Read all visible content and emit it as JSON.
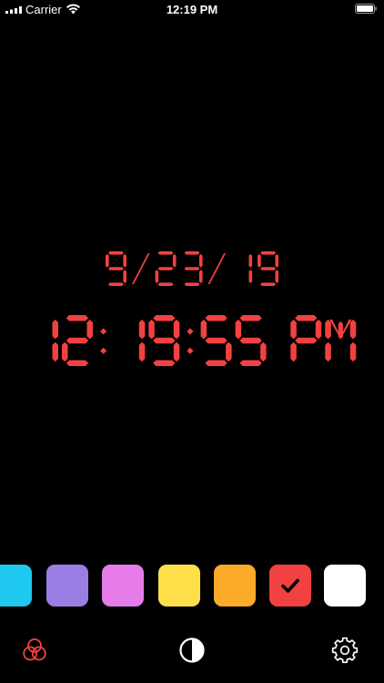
{
  "status_bar": {
    "carrier": "Carrier",
    "time": "12:19 PM"
  },
  "clock": {
    "date": "9/23/19",
    "time": "12:19:55 PM",
    "color": "#f24141"
  },
  "swatches": [
    {
      "name": "cyan",
      "color": "#1ec8ef",
      "selected": false
    },
    {
      "name": "purple",
      "color": "#9a7ee3",
      "selected": false
    },
    {
      "name": "pink",
      "color": "#e67ce9",
      "selected": false
    },
    {
      "name": "yellow",
      "color": "#fde04a",
      "selected": false
    },
    {
      "name": "orange",
      "color": "#fbab28",
      "selected": false
    },
    {
      "name": "red",
      "color": "#f24141",
      "selected": true
    },
    {
      "name": "white",
      "color": "#ffffff",
      "selected": false
    }
  ],
  "toolbar": {
    "left_icon": "color-circles-icon",
    "center_icon": "contrast-icon",
    "right_icon": "gear-icon",
    "accent": "#f24141"
  }
}
